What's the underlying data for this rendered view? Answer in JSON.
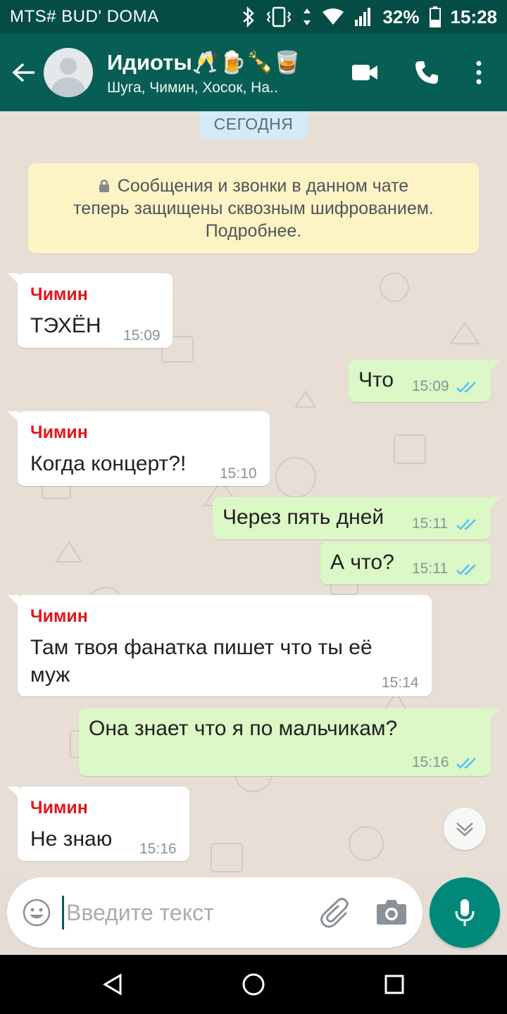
{
  "status_bar": {
    "carrier": "MTS# BUD' DOMA",
    "battery": "32%",
    "time": "15:28"
  },
  "header": {
    "title": "Идиоты🥂🍺🍾🥃",
    "subtitle": "Шуга, Чимин, Хосок, На..",
    "icons": [
      "back-arrow-icon",
      "video-call-icon",
      "phone-icon",
      "more-vert-icon"
    ]
  },
  "chat": {
    "date_chip": "СЕГОДНЯ",
    "encryption_notice": {
      "line1": "Сообщения и звонки в данном чате",
      "line2": "теперь защищены сквозным шифрованием.",
      "line3": "Подробнее."
    },
    "messages": [
      {
        "direction": "in",
        "sender": "Чимин",
        "lines": [
          "ТЭХЁН"
        ],
        "time": "15:09"
      },
      {
        "direction": "out",
        "lines": [
          "Что"
        ],
        "time": "15:09",
        "read": true
      },
      {
        "direction": "in",
        "sender": "Чимин",
        "lines": [
          "Когда концерт?!"
        ],
        "time": "15:10"
      },
      {
        "direction": "out",
        "lines": [
          "Через пять дней"
        ],
        "time": "15:11",
        "read": true
      },
      {
        "direction": "out",
        "lines": [
          "А что?"
        ],
        "time": "15:11",
        "read": true
      },
      {
        "direction": "in",
        "sender": "Чимин",
        "lines": [
          "Там твоя фанатка пишет что ты её",
          "муж"
        ],
        "time": "15:14"
      },
      {
        "direction": "out",
        "lines": [
          "Она знает что я по мальчикам?"
        ],
        "time": "15:16",
        "read": true
      },
      {
        "direction": "in",
        "sender": "Чимин",
        "lines": [
          "Не знаю"
        ],
        "time": "15:16"
      }
    ]
  },
  "composer": {
    "placeholder": "Введите текст",
    "value": ""
  },
  "colors": {
    "header": "#075e54",
    "status_bar": "#054d44",
    "outgoing_bubble": "#dcf8c6",
    "incoming_bubble": "#ffffff",
    "sender_name": "#e0171d",
    "read_ticks": "#4fc3f7",
    "mic_button": "#00897b"
  }
}
